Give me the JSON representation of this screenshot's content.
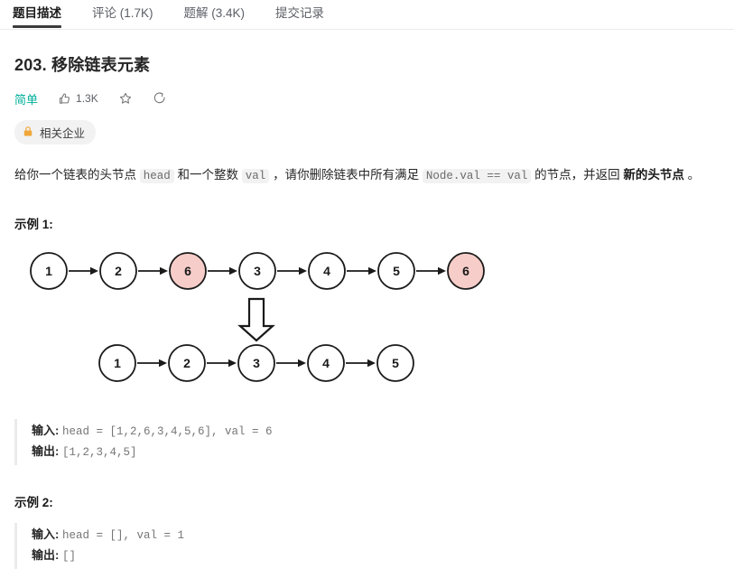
{
  "tabs": [
    {
      "label": "题目描述",
      "active": true
    },
    {
      "label": "评论 (1.7K)",
      "active": false
    },
    {
      "label": "题解 (3.4K)",
      "active": false
    },
    {
      "label": "提交记录",
      "active": false
    }
  ],
  "problem": {
    "title": "203. 移除链表元素",
    "difficulty": "简单",
    "likes": "1.3K",
    "company_badge": "相关企业",
    "description": {
      "part1": "给你一个链表的头节点 ",
      "code1": "head",
      "part2": " 和一个整数 ",
      "code2": "val",
      "part3": " ，请你删除链表中所有满足 ",
      "code3": "Node.val == val",
      "part4": " 的节点，并返回 ",
      "bold1": "新的头节点",
      "part5": " 。"
    }
  },
  "examples": [
    {
      "heading": "示例 1:",
      "input_label": "输入:",
      "input_value": "head = [1,2,6,3,4,5,6], val = 6",
      "output_label": "输出:",
      "output_value": "[1,2,3,4,5]"
    },
    {
      "heading": "示例 2:",
      "input_label": "输入:",
      "input_value": "head = [], val = 1",
      "output_label": "输出:",
      "output_value": "[]"
    }
  ],
  "figure": {
    "before_list": [
      "1",
      "2",
      "6",
      "3",
      "4",
      "5",
      "6"
    ],
    "before_highlighted": [
      false,
      false,
      true,
      false,
      false,
      false,
      true
    ],
    "after_list": [
      "1",
      "2",
      "3",
      "4",
      "5"
    ],
    "highlight_color": "#f6cdc9",
    "node_fill": "#ffffff",
    "node_stroke": "#1a1a1a",
    "arrow_color": "#1a1a1a"
  },
  "colors": {
    "accent_green": "#00af9b",
    "lock_orange": "#f0a73a",
    "tab_active_underline": "#3c3c3c",
    "muted_text": "#767676"
  }
}
